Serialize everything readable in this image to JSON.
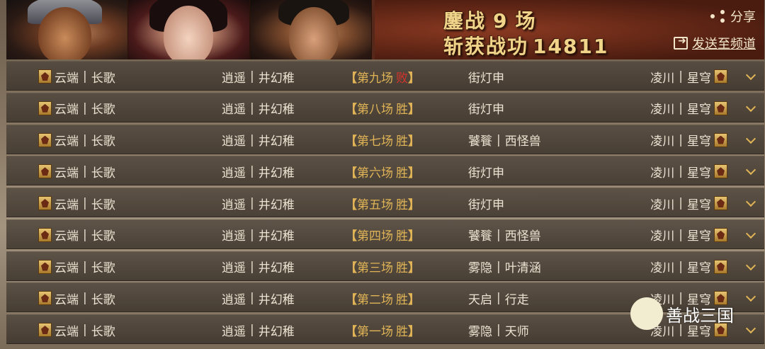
{
  "header": {
    "title_prefix": "鏖战",
    "battle_count": "9",
    "title_suffix": "场",
    "merit_label": "斩获战功",
    "merit_value": "14811",
    "share_label": "分享",
    "send_label": "发送至频道"
  },
  "colors": {
    "gold": "#e0b456",
    "lose_red": "#d8322a",
    "text": "#ece3d2"
  },
  "rows": [
    {
      "left": "云端",
      "left2": "长歌",
      "mid": "逍遥",
      "mid2": "井幻稚",
      "round": "第九场",
      "result": "败",
      "opp": "街灯申",
      "opp2": "",
      "right": "凌川",
      "right2": "星穹"
    },
    {
      "left": "云端",
      "left2": "长歌",
      "mid": "逍遥",
      "mid2": "井幻稚",
      "round": "第八场",
      "result": "胜",
      "opp": "街灯申",
      "opp2": "",
      "right": "凌川",
      "right2": "星穹"
    },
    {
      "left": "云端",
      "left2": "长歌",
      "mid": "逍遥",
      "mid2": "井幻稚",
      "round": "第七场",
      "result": "胜",
      "opp": "饕餮",
      "opp2": "西怪兽",
      "right": "凌川",
      "right2": "星穹"
    },
    {
      "left": "云端",
      "left2": "长歌",
      "mid": "逍遥",
      "mid2": "井幻稚",
      "round": "第六场",
      "result": "胜",
      "opp": "街灯申",
      "opp2": "",
      "right": "凌川",
      "right2": "星穹"
    },
    {
      "left": "云端",
      "left2": "长歌",
      "mid": "逍遥",
      "mid2": "井幻稚",
      "round": "第五场",
      "result": "胜",
      "opp": "街灯申",
      "opp2": "",
      "right": "凌川",
      "right2": "星穹"
    },
    {
      "left": "云端",
      "left2": "长歌",
      "mid": "逍遥",
      "mid2": "井幻稚",
      "round": "第四场",
      "result": "胜",
      "opp": "饕餮",
      "opp2": "西怪兽",
      "right": "凌川",
      "right2": "星穹"
    },
    {
      "left": "云端",
      "left2": "长歌",
      "mid": "逍遥",
      "mid2": "井幻稚",
      "round": "第三场",
      "result": "胜",
      "opp": "雾隐",
      "opp2": "叶清涵",
      "right": "凌川",
      "right2": "星穹"
    },
    {
      "left": "云端",
      "left2": "长歌",
      "mid": "逍遥",
      "mid2": "井幻稚",
      "round": "第二场",
      "result": "胜",
      "opp": "天启",
      "opp2": "行走",
      "right": "凌川",
      "right2": "星穹"
    },
    {
      "left": "云端",
      "left2": "长歌",
      "mid": "逍遥",
      "mid2": "井幻稚",
      "round": "第一场",
      "result": "胜",
      "opp": "雾隐",
      "opp2": "天师",
      "right": "凌川",
      "right2": "星穹"
    }
  ],
  "watermark": "善战三国"
}
